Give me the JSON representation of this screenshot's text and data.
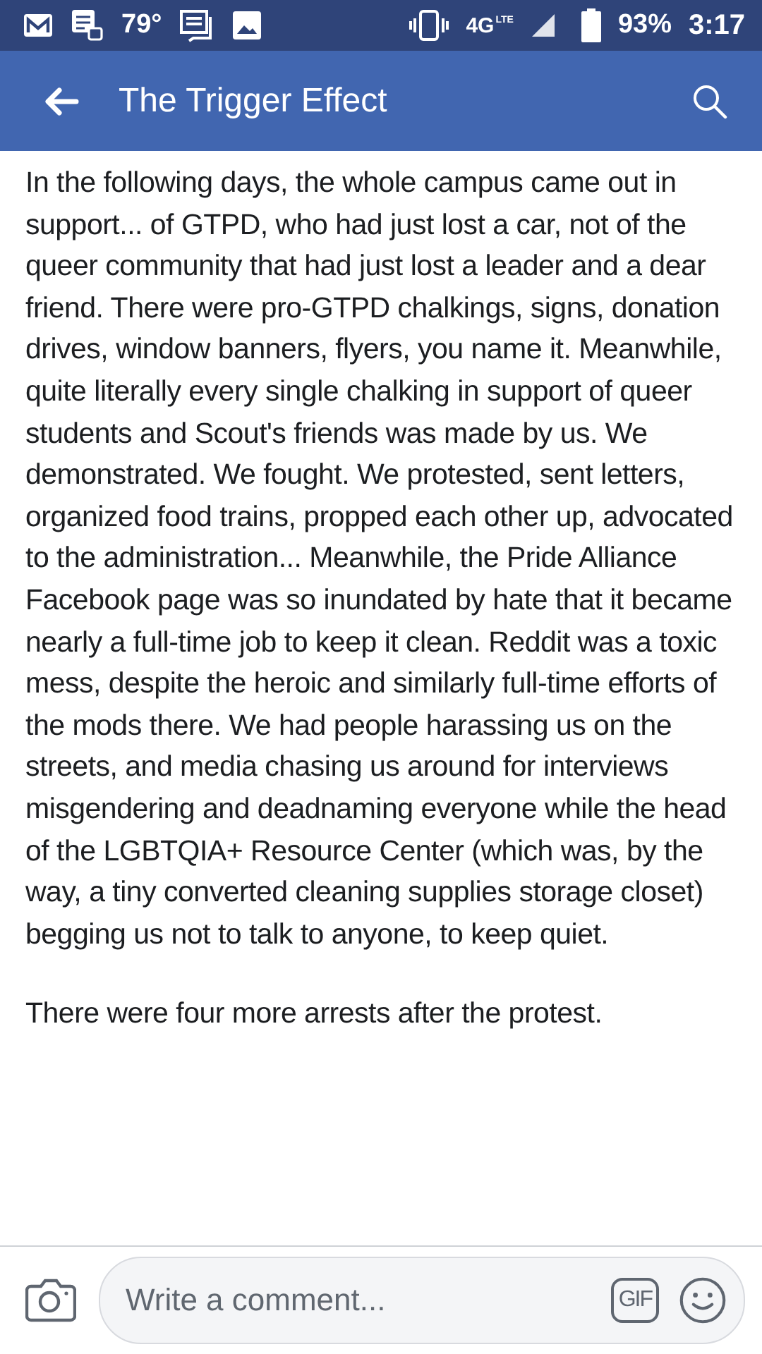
{
  "status_bar": {
    "temperature": "79°",
    "network": "4G",
    "network_sub": "LTE",
    "battery": "93%",
    "time": "3:17"
  },
  "header": {
    "title": "The Trigger Effect"
  },
  "paragraphs": [
    "In the following days, the whole campus came out in support... of GTPD, who had just lost a car, not of the queer community that had just lost a leader and a dear friend. There were pro-GTPD chalkings, signs, donation drives, window banners, flyers, you name it. Meanwhile, quite literally every single chalking in support of queer students and Scout's friends was made by us. We demonstrated. We fought. We protested, sent letters, organized food trains, propped each other up, advocated to the administration... Meanwhile, the Pride Alliance Facebook page was so inundated by hate that it became nearly a full-time job to keep it clean. Reddit was a toxic mess, despite the heroic and similarly full-time efforts of the mods there. We had people harassing us on the streets, and media chasing us around for interviews misgendering and deadnaming everyone while the head of the LGBTQIA+ Resource Center (which was, by the way, a tiny converted cleaning supplies storage closet) begging us not to talk to anyone, to keep quiet.",
    "There were four more arrests after the protest."
  ],
  "comment_bar": {
    "placeholder": "Write a comment...",
    "gif_label": "GIF"
  }
}
